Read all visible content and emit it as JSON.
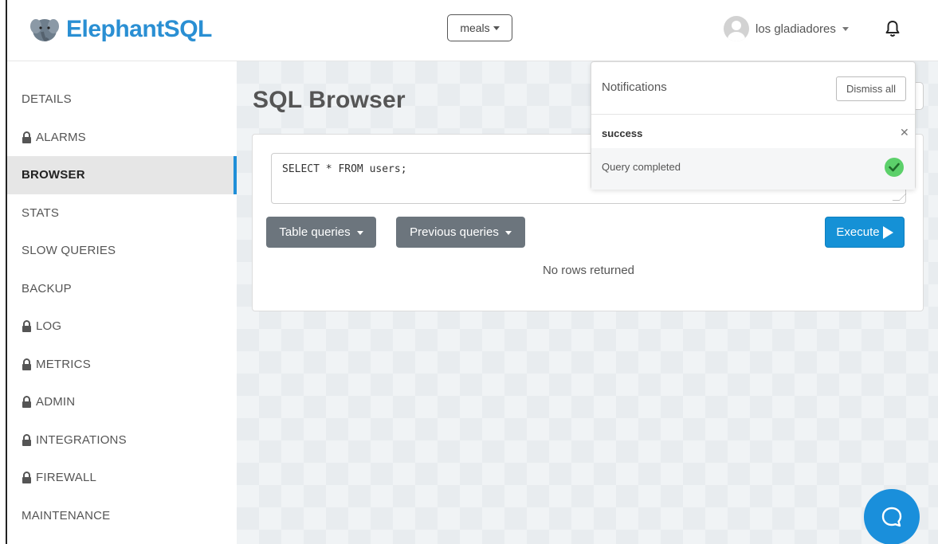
{
  "brand": {
    "name": "ElephantSQL"
  },
  "header": {
    "database_select": "meals",
    "user_name": "los gladiadores"
  },
  "sidebar": {
    "items": [
      {
        "label": "DETAILS",
        "locked": false,
        "active": false
      },
      {
        "label": "ALARMS",
        "locked": true,
        "active": false
      },
      {
        "label": "BROWSER",
        "locked": false,
        "active": true
      },
      {
        "label": "STATS",
        "locked": false,
        "active": false
      },
      {
        "label": "SLOW QUERIES",
        "locked": false,
        "active": false
      },
      {
        "label": "BACKUP",
        "locked": false,
        "active": false
      },
      {
        "label": "LOG",
        "locked": true,
        "active": false
      },
      {
        "label": "METRICS",
        "locked": true,
        "active": false
      },
      {
        "label": "ADMIN",
        "locked": true,
        "active": false
      },
      {
        "label": "INTEGRATIONS",
        "locked": true,
        "active": false
      },
      {
        "label": "FIREWALL",
        "locked": true,
        "active": false
      },
      {
        "label": "MAINTENANCE",
        "locked": false,
        "active": false
      }
    ]
  },
  "main": {
    "title": "SQL Browser",
    "query": "SELECT * FROM users;",
    "table_queries_label": "Table queries",
    "previous_queries_label": "Previous queries",
    "execute_label": "Execute",
    "result_text": "No rows returned"
  },
  "notifications": {
    "title": "Notifications",
    "dismiss_label": "Dismiss all",
    "items": [
      {
        "type": "success",
        "message": "Query completed"
      }
    ]
  },
  "colors": {
    "brand": "#2a8fd3",
    "primary_button": "#1591d6",
    "secondary_button": "#6c757d",
    "active_indicator": "#1f8fd8",
    "success": "#5cd06a"
  }
}
